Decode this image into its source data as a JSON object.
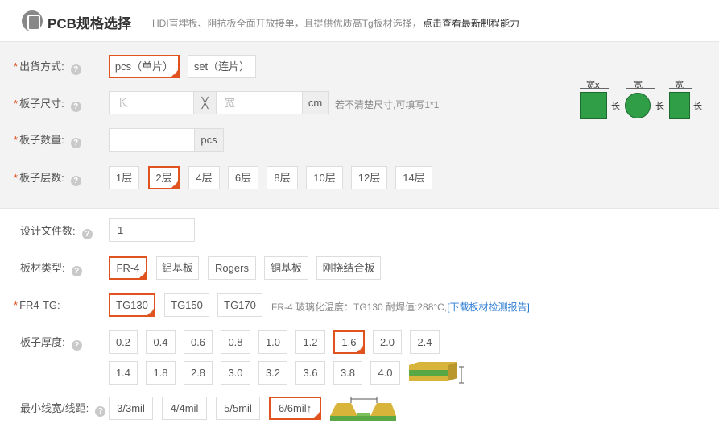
{
  "header": {
    "title": "PCB规格选择",
    "desc": "HDI盲埋板、阻抗板全面开放接单，且提供优质高Tg板材选择，",
    "link": "点击查看最新制程能力"
  },
  "help_glyph": "?",
  "required_mark": "*",
  "ship": {
    "label": "出货方式:",
    "options": [
      "pcs（单片）",
      "set（连片）"
    ],
    "selected": "pcs（单片）"
  },
  "size": {
    "label": "板子尺寸:",
    "length_placeholder": "长",
    "times": "╳",
    "width_placeholder": "宽",
    "unit": "cm",
    "hint": "若不清楚尺寸,可填写1*1"
  },
  "qty": {
    "label": "板子数量:",
    "unit": "pcs"
  },
  "layers": {
    "label": "板子层数:",
    "options": [
      "1层",
      "2层",
      "4层",
      "6层",
      "8层",
      "10层",
      "12层",
      "14层"
    ],
    "selected": "2层"
  },
  "diagram": {
    "w1": "宽x",
    "w2": "宽",
    "w3": "宽",
    "h1": "长",
    "h2": "长",
    "h3": "长"
  },
  "design_files": {
    "label": "设计文件数:",
    "value": "1"
  },
  "material": {
    "label": "板材类型:",
    "options": [
      "FR-4",
      "铝基板",
      "Rogers",
      "铜基板",
      "刚挠结合板"
    ],
    "selected": "FR-4"
  },
  "tg": {
    "label": "FR4-TG:",
    "options": [
      "TG130",
      "TG150",
      "TG170"
    ],
    "selected": "TG130",
    "hint": "FR-4 玻璃化温度：TG130 耐焊值:288°C,",
    "hint_link": "[下载板材检测报告]"
  },
  "thickness": {
    "label": "板子厚度:",
    "row1": [
      "0.2",
      "0.4",
      "0.6",
      "0.8",
      "1.0",
      "1.2",
      "1.6",
      "2.0",
      "2.4"
    ],
    "row2": [
      "1.4",
      "1.8",
      "2.8",
      "3.0",
      "3.2",
      "3.6",
      "3.8",
      "4.0"
    ],
    "selected": "1.6"
  },
  "trace": {
    "label": "最小线宽/线距:",
    "options": [
      "3/3mil",
      "4/4mil",
      "5/5mil",
      "6/6mil↑"
    ],
    "selected": "6/6mil↑"
  },
  "colors": {
    "accent": "#e0521e",
    "link": "#2a7ad2",
    "panel": "#f3f3f4"
  }
}
